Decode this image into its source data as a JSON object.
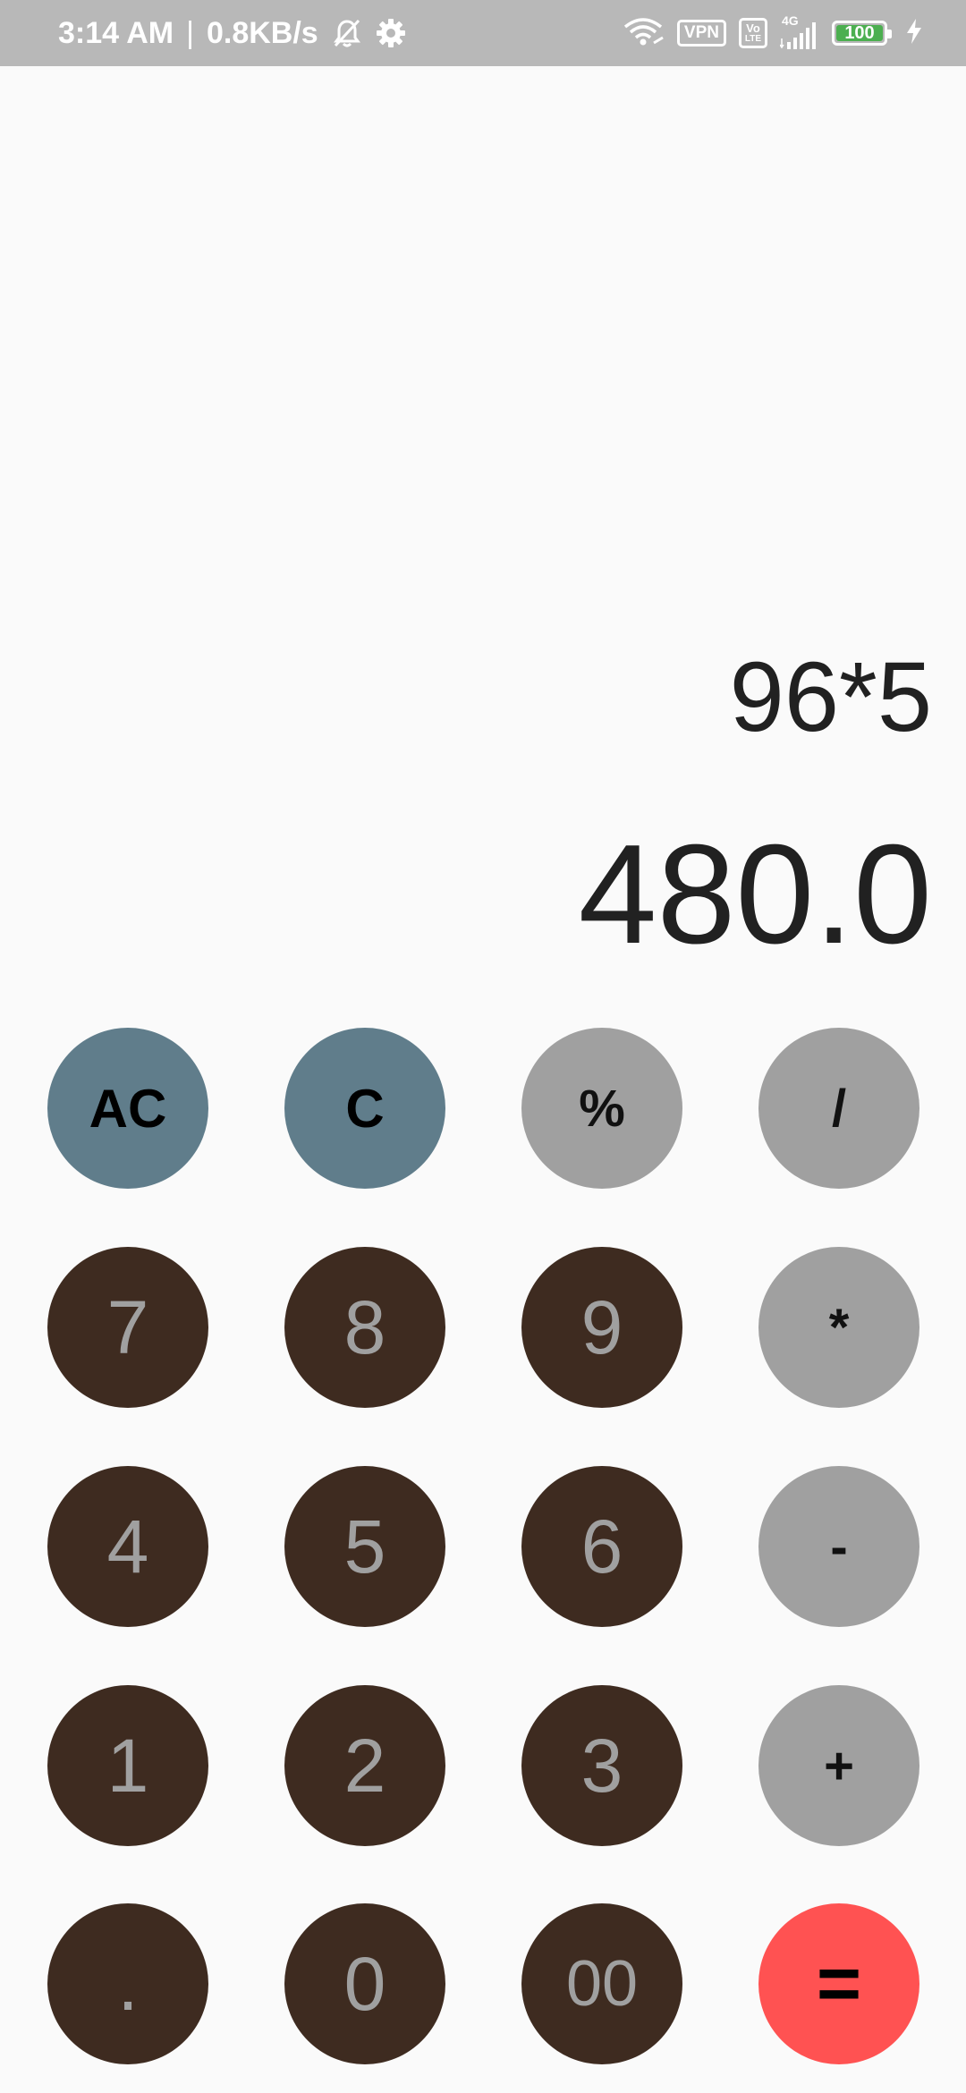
{
  "status_bar": {
    "time": "3:14 AM",
    "separator": "|",
    "speed": "0.8KB/s",
    "icons": [
      "mute-bell-icon",
      "settings-gear-icon",
      "wifi-icon",
      "vpn-icon",
      "volte-icon",
      "signal-4g-icon",
      "battery-icon",
      "charging-icon"
    ],
    "vpn_label": "VPN",
    "volte_top": "Vo",
    "volte_bottom": "LTE",
    "network_label": "4G",
    "battery_level": "100",
    "battery_color": "#4caf50"
  },
  "display": {
    "expression": "96*5",
    "result": "480.0"
  },
  "keypad": {
    "row1": {
      "ac": "AC",
      "c": "C",
      "percent": "%",
      "divide": "/"
    },
    "row2": {
      "seven": "7",
      "eight": "8",
      "nine": "9",
      "multiply": "*"
    },
    "row3": {
      "four": "4",
      "five": "5",
      "six": "6",
      "minus": "-"
    },
    "row4": {
      "one": "1",
      "two": "2",
      "three": "3",
      "plus": "+"
    },
    "row5": {
      "dot": ".",
      "zero": "0",
      "double_zero": "00",
      "equals": "="
    }
  },
  "colors": {
    "background": "#fafafa",
    "status_bar": "#b8b8b8",
    "digit_key": "#3e2b20",
    "digit_text": "#a0a0a0",
    "operator_key": "#a0a0a0",
    "clear_key": "#607d8b",
    "equals_key": "#ff5252",
    "display_text": "#212121"
  }
}
